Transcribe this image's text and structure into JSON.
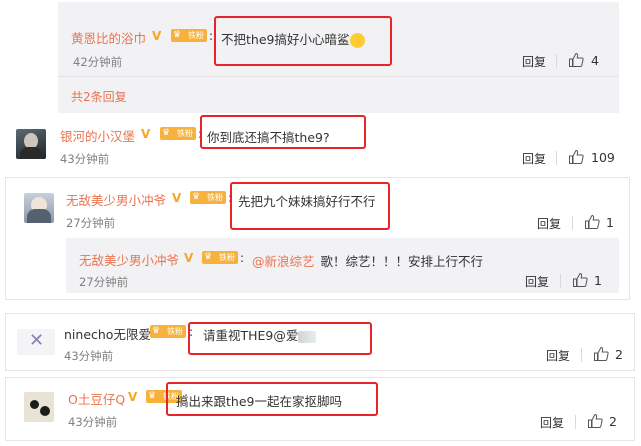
{
  "comments": [
    {
      "user": "黄恩比的浴巾",
      "badge": "铁粉",
      "colon": ":",
      "text": "不把the9搞好小心暗鲨",
      "time": "42分钟前",
      "reply": "回复",
      "likes": "4"
    },
    {
      "more": "共2条回复"
    },
    {
      "user": "银河的小汉堡",
      "badge": "铁粉",
      "colon": ":",
      "text": "你到底还搞不搞the9?",
      "time": "43分钟前",
      "reply": "回复",
      "likes": "109"
    },
    {
      "user": "无敌美少男小冲爷",
      "badge": "铁粉",
      "colon": ":",
      "text": "先把九个妹妹搞好行不行",
      "time": "27分钟前",
      "reply": "回复",
      "likes": "1"
    },
    {
      "user": "无敌美少男小冲爷",
      "badge": "铁粉",
      "colon": ":",
      "mention": "@新浪综艺",
      "text": "歌！综艺！！！安排上行不行",
      "time": "27分钟前",
      "reply": "回复",
      "likes": "1"
    },
    {
      "user": "ninecho无限爱",
      "badge": "铁粉",
      "colon": ":",
      "text": "请重视THE9@爱",
      "time": "43分钟前",
      "reply": "回复",
      "likes": "2"
    },
    {
      "user": "O土豆仔Q",
      "badge": "铁粉",
      "colon": ":",
      "text": "搞出来跟the9一起在家抠脚吗",
      "time": "43分钟前",
      "reply": "回复",
      "likes": "2"
    }
  ],
  "colors": {
    "username": "#eb7350",
    "highlight": "#e8232a",
    "badge": "#f7b23e",
    "v_badge": "#f6a623",
    "sub_bg": "#f2f2f5"
  },
  "icons": [
    "thumbs-up-icon",
    "v-verified-icon",
    "fan-badge-icon"
  ]
}
